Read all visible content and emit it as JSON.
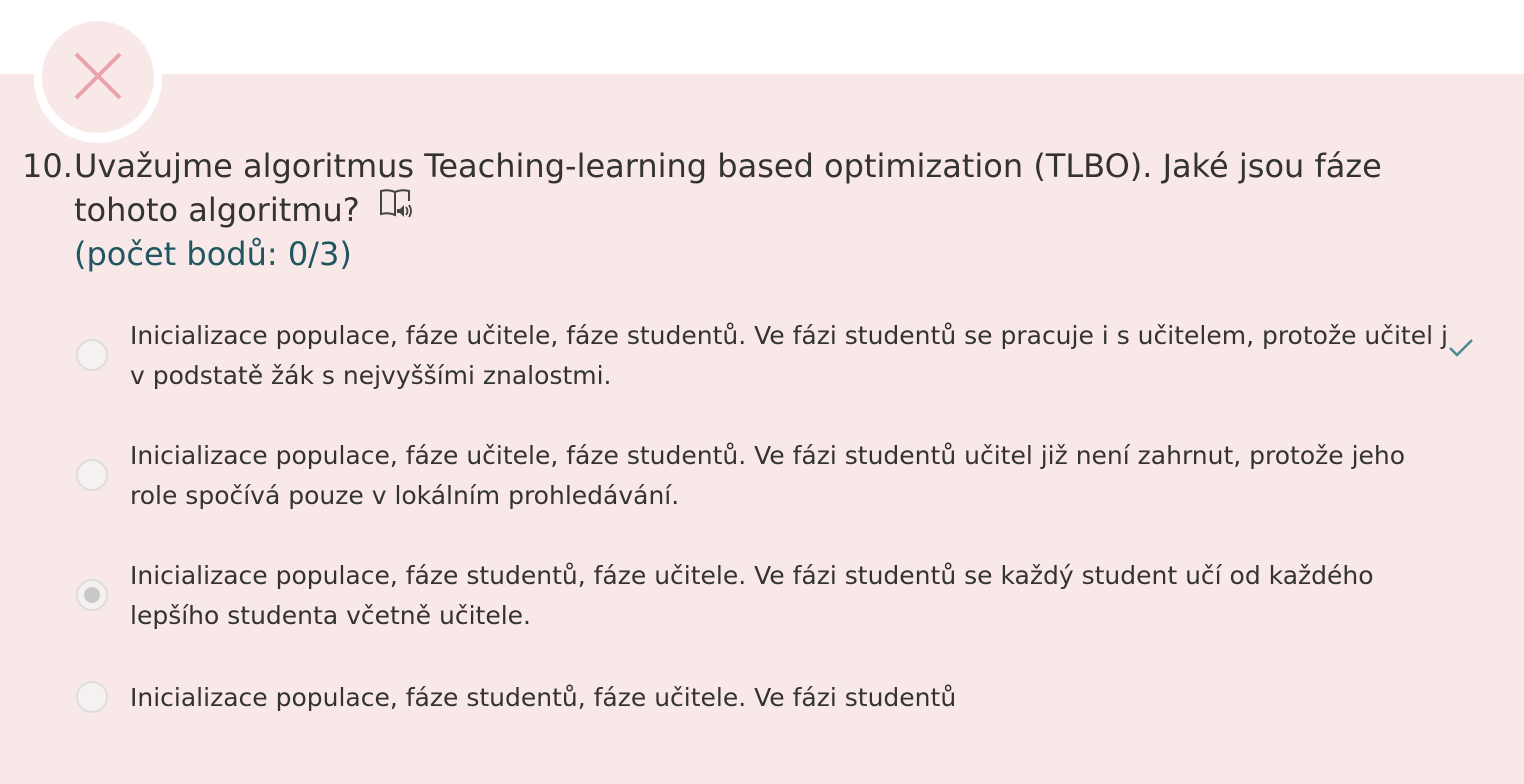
{
  "question": {
    "number": "10.",
    "text": "Uvažujme algoritmus Teaching-learning based optimization (TLBO). Jaké jsou fáze tohoto algoritmu?",
    "points": "(počet bodů: 0/3)",
    "status_icon": "close-icon",
    "status_color": "#e8a3a8",
    "speaker_icon": "speaker-book-icon"
  },
  "options": [
    {
      "label": "Inicializace populace, fáze učitele, fáze studentů. Ve fázi studentů se pracuje i s učitelem, protože učitel j v podstatě žák s nejvyššími znalostmi.",
      "selected": false,
      "correct": true
    },
    {
      "label": "Inicializace populace, fáze učitele, fáze studentů. Ve fázi studentů učitel již není zahrnut, protože jeho role spočívá pouze v lokálním prohledávání.",
      "selected": false,
      "correct": false
    },
    {
      "label": "Inicializace populace, fáze studentů, fáze učitele. Ve fázi studentů se každý student učí od každého lepšího studenta včetně učitele.",
      "selected": true,
      "correct": false
    },
    {
      "label": "Inicializace populace, fáze studentů, fáze učitele. Ve fázi studentů",
      "selected": false,
      "correct": false
    }
  ],
  "colors": {
    "panel_background": "#f9e8e8",
    "points_text": "#1f5660",
    "correct_mark": "#4a8a8f"
  }
}
